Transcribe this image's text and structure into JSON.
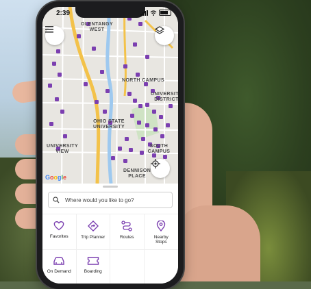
{
  "status_bar": {
    "time": "2:39"
  },
  "map": {
    "labels": {
      "olentangy_west": "OLENTANGY\nWEST",
      "north_campus": "NORTH CAMPUS",
      "university_district": "UNIVERSITY\nDISTRICT",
      "ohio_state_university": "OHIO STATE\nUNIVERSITY",
      "university_view": "UNIVERSITY\nVIEW",
      "south_campus": "SOUTH CAMPUS",
      "dennison_place": "DENNISON\nPLACE"
    },
    "attribution": [
      "G",
      "o",
      "o",
      "g",
      "l",
      "e"
    ],
    "stop_color": "#7b3fb0"
  },
  "search": {
    "placeholder": "Where would you like to go?"
  },
  "menu": [
    {
      "label": "Favorites",
      "icon": "heart-icon"
    },
    {
      "label": "Trip Planner",
      "icon": "directions-icon"
    },
    {
      "label": "Routes",
      "icon": "routes-icon"
    },
    {
      "label": "Nearby\nStops",
      "icon": "location-pin-icon"
    },
    {
      "label": "On Demand",
      "icon": "car-icon"
    },
    {
      "label": "Boarding",
      "icon": "ticket-icon"
    },
    {
      "label": "",
      "icon": ""
    },
    {
      "label": "",
      "icon": ""
    }
  ],
  "colors": {
    "accent": "#7b3fb0",
    "highway": "#f3c24a",
    "river": "#9ec9ef"
  }
}
